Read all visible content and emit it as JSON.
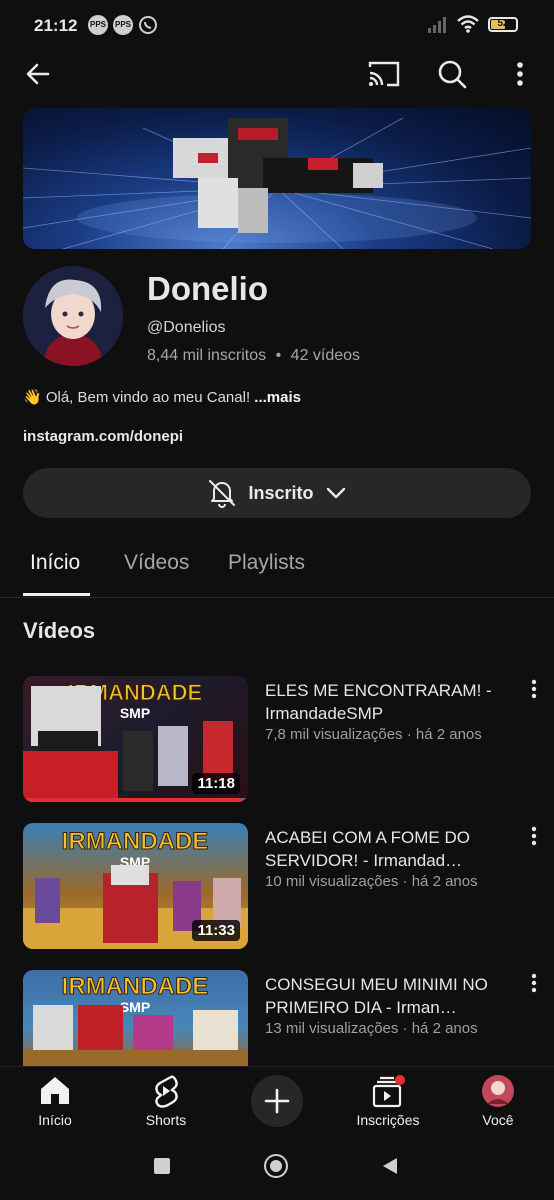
{
  "status_bar": {
    "time": "21:12",
    "battery": "52",
    "battery_level": 0.52
  },
  "channel": {
    "name": "Donelio",
    "handle": "@Donelios",
    "subscribers": "8,44 mil inscritos",
    "videos_count": "42 vídeos",
    "separator": "•",
    "description": "👋 Olá, Bem vindo ao meu Canal!",
    "more_label": "...mais",
    "link": "instagram.com/donepi",
    "subscribe_label": "Inscrito"
  },
  "tabs": [
    {
      "label": "Início",
      "active": true
    },
    {
      "label": "Vídeos",
      "active": false
    },
    {
      "label": "Playlists",
      "active": false
    }
  ],
  "section_title": "Vídeos",
  "videos": [
    {
      "title": "ELES ME ENCONTRARAM! - IrmandadeSMP",
      "meta": "7,8 mil visualizações · há 2 anos",
      "duration": "11:18",
      "thumb_text": "IRMANDADE",
      "thumb_sub": "SMP",
      "watched": 0.97
    },
    {
      "title": "ACABEI COM A FOME DO SERVIDOR! - Irmandad…",
      "meta": "10 mil visualizações · há 2 anos",
      "duration": "11:33",
      "thumb_text": "IRMANDADE",
      "thumb_sub": "SMP",
      "watched": 0.0
    },
    {
      "title": "CONSEGUI MEU MINIMI NO PRIMEIRO DIA - Irman…",
      "meta": "13 mil visualizações · há 2 anos",
      "duration": "",
      "thumb_text": "IRMANDADE",
      "thumb_sub": "SMP",
      "watched": 0.0
    }
  ],
  "bottom_nav": [
    {
      "label": "Início",
      "icon": "home-icon"
    },
    {
      "label": "Shorts",
      "icon": "shorts-icon"
    },
    {
      "label": "",
      "icon": "create-icon"
    },
    {
      "label": "Inscrições",
      "icon": "subscriptions-icon"
    },
    {
      "label": "Você",
      "icon": "you-avatar-icon"
    }
  ],
  "colors": {
    "background": "#0f0f0f",
    "button": "#272727",
    "accent_red": "#e8302a",
    "secondary_text": "#a6a6a6"
  }
}
